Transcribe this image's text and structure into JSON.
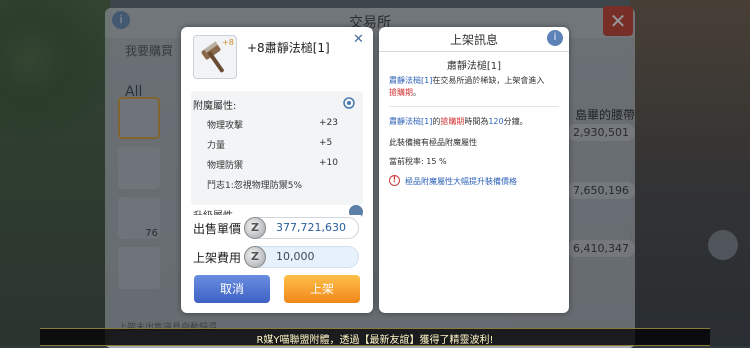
{
  "background": {
    "window_title": "交易所",
    "sub_tab": "我要購買",
    "filter_all": "All",
    "rows": [
      {
        "name": "島畢的腰帶",
        "price": "2,930,501"
      },
      {
        "name": "",
        "price": "7,650,196"
      },
      {
        "name": "",
        "price": "6,410,347"
      }
    ],
    "slot_count_label": "76",
    "bottom_hint": "上架未出售道具自動歸還"
  },
  "item": {
    "refine": "+8",
    "title": "+8肅靜法槌[1]",
    "close_icon": "close-cross-icon"
  },
  "attributes": {
    "header": "附魔屬性:",
    "rows": [
      {
        "label": "物理攻擊",
        "value": "+23"
      },
      {
        "label": "力量",
        "value": "+5"
      },
      {
        "label": "物理防禦",
        "value": "+10"
      }
    ],
    "note": "鬥志1:忽視物理防禦5%",
    "next_section": "升級屬性"
  },
  "sale": {
    "price_label": "出售單價",
    "price_value": "377,721,630",
    "fee_label": "上架費用",
    "fee_value": "10,000",
    "currency_icon": "zeny-coin-icon",
    "cancel_label": "取消",
    "list_label": "上架"
  },
  "info": {
    "title": "上架訊息",
    "item_name": "肅靜法槌[1]",
    "line1_a": "肅靜法槌[1]",
    "line1_b": "在交易所過於稀缺，上架會進入",
    "line1_c": "搶購期",
    "line1_d": "。",
    "line2_a": "肅靜法槌[1]",
    "line2_b": "的",
    "line2_c": "搶購期",
    "line2_d": "時間為",
    "line2_e": "120",
    "line2_f": "分鐘。",
    "line3": "此裝備擁有極品附魔屬性",
    "line4": "當前稅率: 15 %",
    "warning": "極品附魔屬性大幅提升裝備價格"
  },
  "ticker": "R媒Y喵聯盟附體，透過【最新友誼】獲得了精靈波利!",
  "colors": {
    "accent_blue": "#2f63b8",
    "accent_red": "#d23b3b",
    "button_cancel": "#3e61c4",
    "button_list": "#f0861a"
  }
}
